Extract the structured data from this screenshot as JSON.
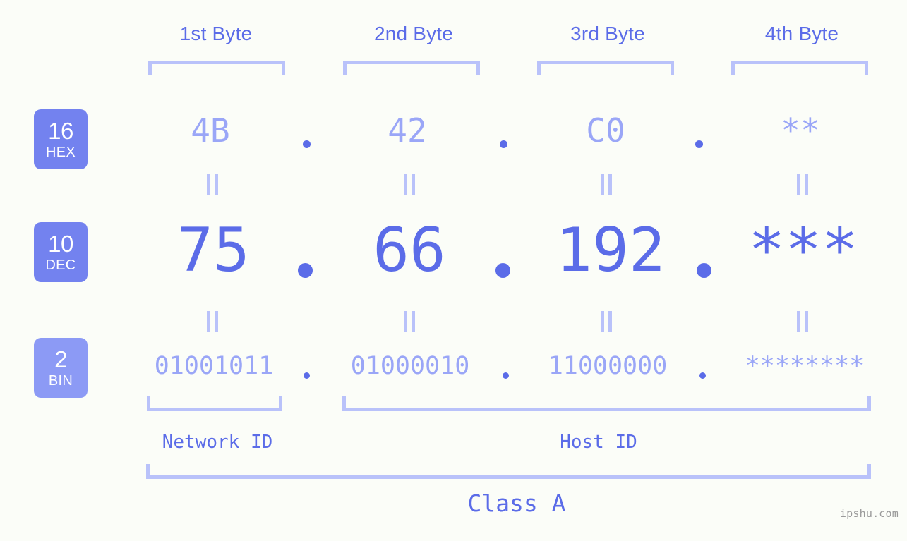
{
  "meta": {
    "watermark": "ipshu.com",
    "background_color": "#fbfdf8",
    "accent_color": "#5b6ce8",
    "accent_light_color": "#9aa6f7",
    "bracket_color": "#b9c2fa",
    "badge_color": "#7382ef",
    "badge_light_color": "#8c9af5"
  },
  "byte_headers": [
    {
      "label": "1st Byte"
    },
    {
      "label": "2nd Byte"
    },
    {
      "label": "3rd Byte"
    },
    {
      "label": "4th Byte"
    }
  ],
  "rows": [
    {
      "id": "hex",
      "badge_number": "16",
      "badge_name": "HEX",
      "values": [
        "4B",
        "42",
        "C0",
        "**"
      ],
      "separator": "."
    },
    {
      "id": "dec",
      "badge_number": "10",
      "badge_name": "DEC",
      "values": [
        "75",
        "66",
        "192",
        "***"
      ],
      "separator": "."
    },
    {
      "id": "bin",
      "badge_number": "2",
      "badge_name": "BIN",
      "values": [
        "01001011",
        "01000010",
        "11000000",
        "********"
      ],
      "separator": "."
    }
  ],
  "equality_mark": "‖",
  "segments": [
    {
      "label": "Network ID"
    },
    {
      "label": "Host ID"
    }
  ],
  "class": {
    "label": "Class A"
  }
}
